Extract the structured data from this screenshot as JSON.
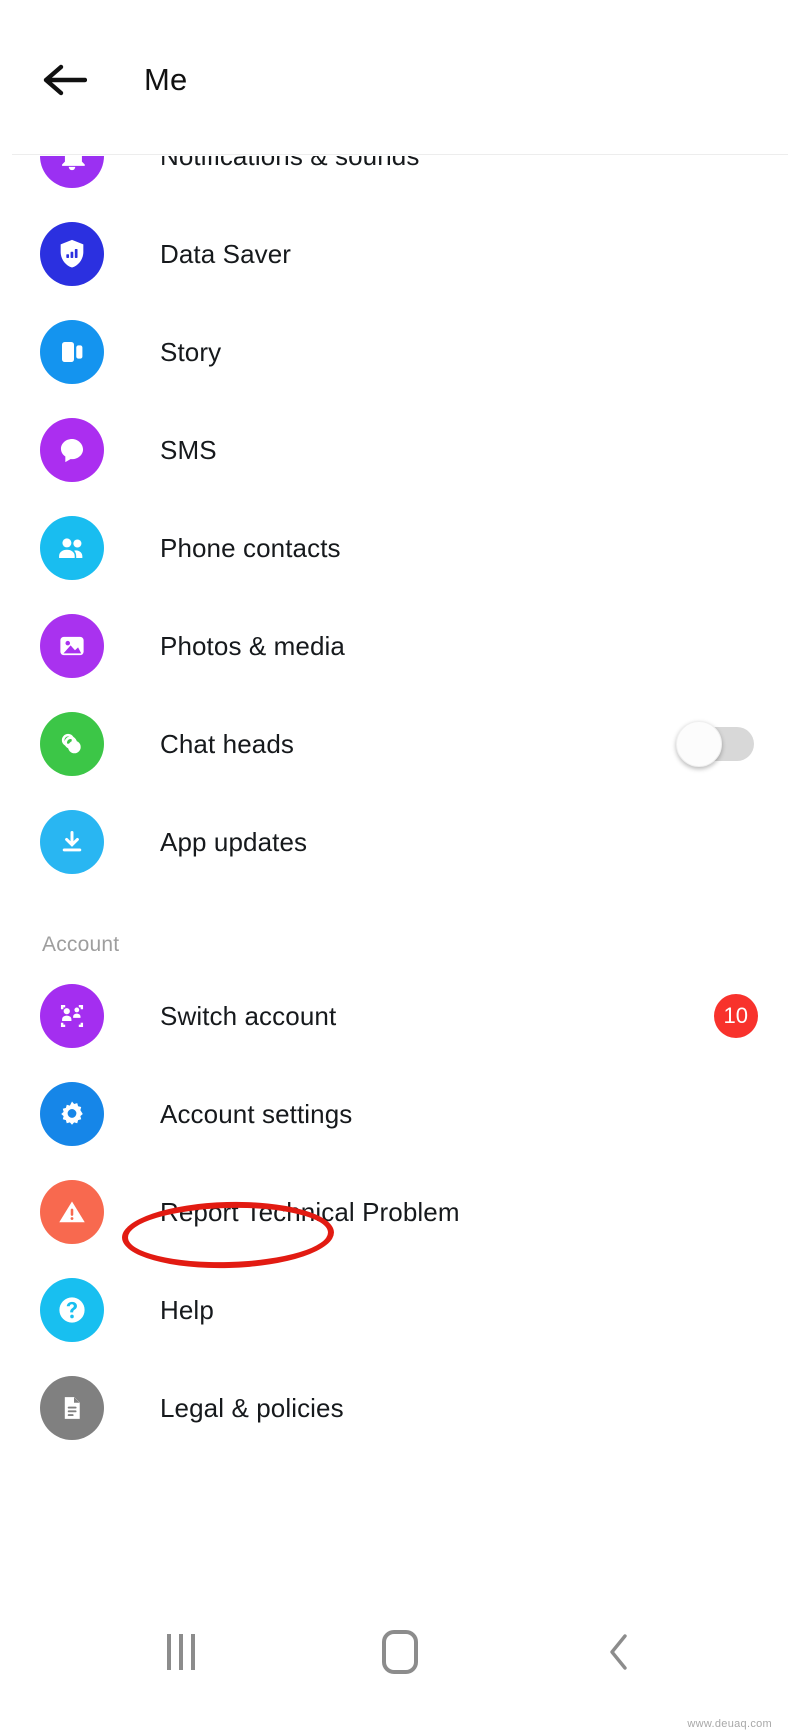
{
  "header": {
    "title": "Me",
    "back_icon": "arrow-left-icon"
  },
  "list": {
    "items": [
      {
        "label": "Notifications & sounds",
        "icon": "bell-icon",
        "color": "#9b30f2",
        "accessory": "none"
      },
      {
        "label": "Data Saver",
        "icon": "shield-bars-icon",
        "color": "#2b30e0",
        "accessory": "none"
      },
      {
        "label": "Story",
        "icon": "story-icon",
        "color": "#1494ef",
        "accessory": "none"
      },
      {
        "label": "SMS",
        "icon": "chat-bubble-icon",
        "color": "#ab2ef0",
        "accessory": "none"
      },
      {
        "label": "Phone contacts",
        "icon": "people-icon",
        "color": "#19bdf0",
        "accessory": "none"
      },
      {
        "label": "Photos & media",
        "icon": "photo-icon",
        "color": "#a932ef",
        "accessory": "none"
      },
      {
        "label": "Chat heads",
        "icon": "chat-heads-icon",
        "color": "#3cc647",
        "accessory": "toggle"
      },
      {
        "label": "App updates",
        "icon": "download-icon",
        "color": "#29b6f2",
        "accessory": "none"
      }
    ]
  },
  "account_section": {
    "title": "Account",
    "items": [
      {
        "label": "Switch account",
        "icon": "switch-account-icon",
        "color": "#a42ef0",
        "accessory": "badge",
        "badge": "10"
      },
      {
        "label": "Account settings",
        "icon": "gear-icon",
        "color": "#1686e8",
        "accessory": "none",
        "highlighted": true
      },
      {
        "label": "Report Technical Problem",
        "icon": "warning-icon",
        "color": "#f8694f",
        "accessory": "none"
      },
      {
        "label": "Help",
        "icon": "question-icon",
        "color": "#18bff0",
        "accessory": "none"
      },
      {
        "label": "Legal & policies",
        "icon": "document-icon",
        "color": "#808080",
        "accessory": "none"
      }
    ]
  },
  "toggle": {
    "chat_heads_state": "off"
  },
  "annotation": {
    "shape": "ellipse",
    "color": "#e21b12",
    "target": "Account settings"
  },
  "navbar": {
    "recents_icon": "recents-icon",
    "home_icon": "home-icon",
    "back_icon": "chevron-left-icon"
  },
  "watermark": "www.deuaq.com"
}
